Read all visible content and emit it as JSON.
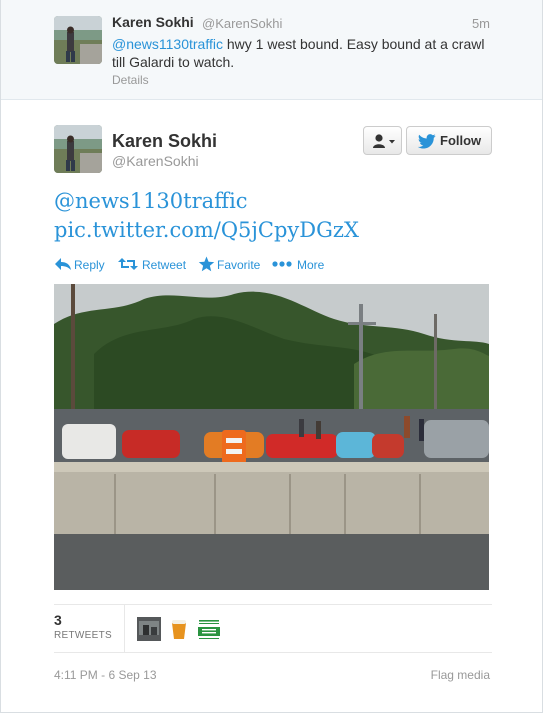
{
  "previous_tweet": {
    "name": "Karen Sokhi",
    "handle": "@KarenSokhi",
    "time": "5m",
    "mention": "@news1130traffic",
    "text": " hwy 1 west bound. Easy bound at a crawl till Galardi to watch.",
    "details_label": "Details"
  },
  "tweet": {
    "name": "Karen Sokhi",
    "handle": "@KarenSokhi",
    "follow_label": "Follow",
    "mention": "@news1130traffic",
    "link": "pic.twitter.com/Q5jCpyDGzX",
    "actions": {
      "reply": "Reply",
      "retweet": "Retweet",
      "favorite": "Favorite",
      "more": "More"
    },
    "retweet_count": "3",
    "retweets_label": "RETWEETS",
    "retweeter_logo_text": "News 1130",
    "timestamp": "4:11 PM - 6 Sep 13",
    "flag_media": "Flag media"
  },
  "colors": {
    "link": "#2a93d8",
    "muted": "#999999",
    "text": "#333333"
  },
  "icons": [
    "user-menu-icon",
    "twitter-bird-icon",
    "reply-icon",
    "retweet-icon",
    "favorite-icon",
    "more-icon"
  ]
}
